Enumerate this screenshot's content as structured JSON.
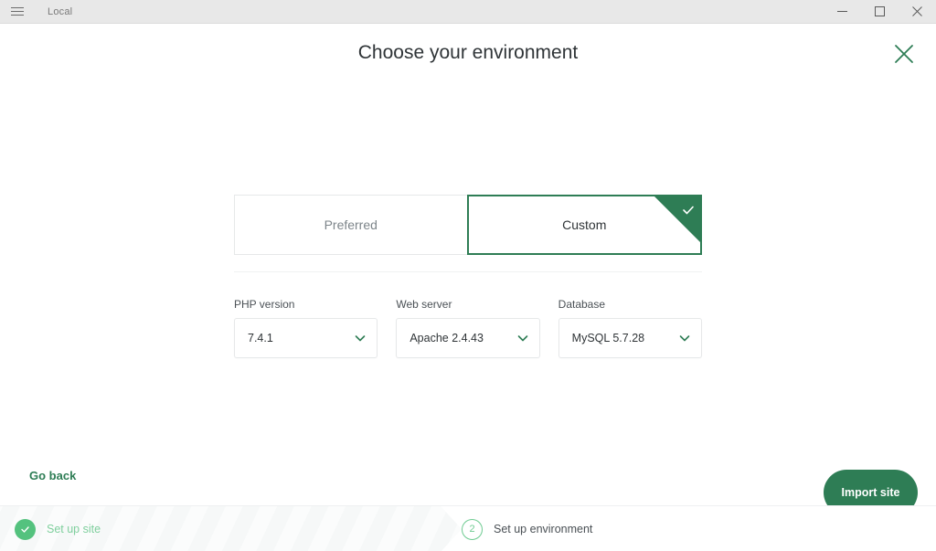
{
  "titlebar": {
    "menu_icon": "hamburger-icon",
    "app_name": "Local",
    "minimize_icon": "minimize-icon",
    "maximize_icon": "maximize-icon",
    "close_icon": "close-icon"
  },
  "header": {
    "title": "Choose your environment",
    "close_icon": "close-icon",
    "close_color": "#2e7d55"
  },
  "environment_tabs": {
    "options": [
      {
        "label": "Preferred",
        "selected": false
      },
      {
        "label": "Custom",
        "selected": true
      }
    ],
    "selected_color": "#2e7d55",
    "check_icon": "check-icon"
  },
  "fields": [
    {
      "label": "PHP version",
      "value": "7.4.1",
      "chevron_icon": "chevron-down-icon"
    },
    {
      "label": "Web server",
      "value": "Apache 2.4.43",
      "chevron_icon": "chevron-down-icon"
    },
    {
      "label": "Database",
      "value": "MySQL 5.7.28",
      "chevron_icon": "chevron-down-icon"
    }
  ],
  "actions": {
    "back_label": "Go back",
    "primary_label": "Import site",
    "primary_color": "#2e7d55"
  },
  "steps": [
    {
      "badge": "✓",
      "label": "Set up site",
      "state": "done"
    },
    {
      "badge": "2",
      "label": "Set up environment",
      "state": "current"
    }
  ]
}
